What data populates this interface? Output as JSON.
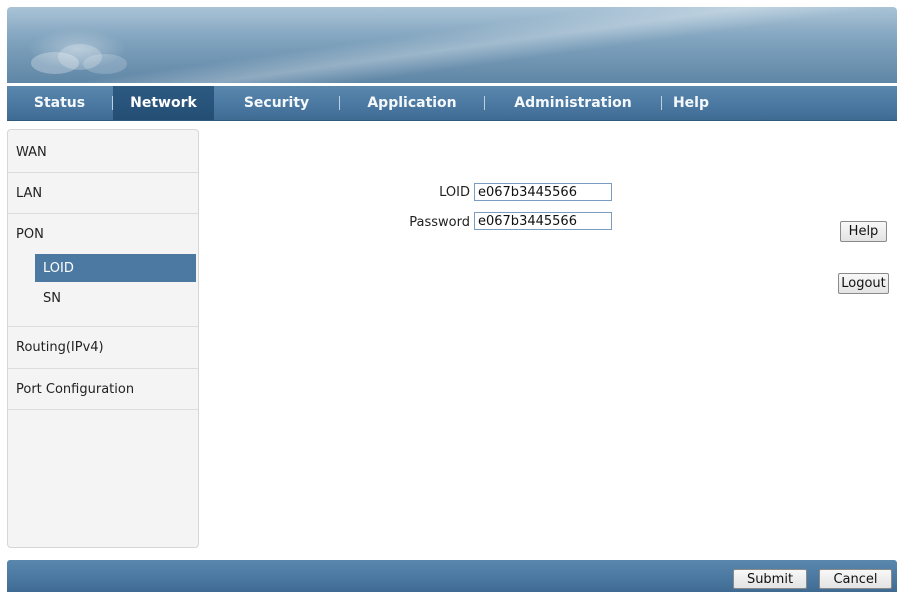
{
  "topnav": {
    "items": [
      {
        "label": "Status",
        "active": false
      },
      {
        "label": "Network",
        "active": true
      },
      {
        "label": "Security",
        "active": false
      },
      {
        "label": "Application",
        "active": false
      },
      {
        "label": "Administration",
        "active": false
      },
      {
        "label": "Help",
        "active": false
      }
    ]
  },
  "sidebar": {
    "items": [
      {
        "label": "WAN"
      },
      {
        "label": "LAN"
      },
      {
        "label": "PON"
      },
      {
        "label": "Routing(IPv4)"
      },
      {
        "label": "Port Configuration"
      }
    ],
    "pon_subitems": [
      {
        "label": "LOID",
        "active": true
      },
      {
        "label": "SN",
        "active": false
      }
    ]
  },
  "form": {
    "loid_label": "LOID",
    "loid_value": "e067b3445566",
    "password_label": "Password",
    "password_value": "e067b3445566"
  },
  "side_buttons": {
    "help_label": "Help",
    "logout_label": "Logout"
  },
  "footer": {
    "submit_label": "Submit",
    "cancel_label": "Cancel"
  },
  "colors": {
    "nav_bg": "#4a77a0",
    "nav_active": "#244e74",
    "sidebar_active": "#4b79a1"
  }
}
